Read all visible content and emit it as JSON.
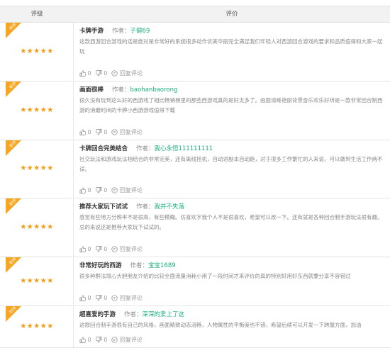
{
  "header": {
    "rating_label": "评级",
    "review_label": "评价"
  },
  "badge_text": "好评",
  "colors": {
    "badge": "#f5a623",
    "star": "#f39c12",
    "username": "#1aaf7a"
  },
  "reviews": [
    {
      "title": "卡牌手游",
      "author_label": "作者：",
      "username": "子健69",
      "stars": "★★★★★",
      "body": "这款西游回合游戏的话是绝对是非常好的系统很多动作优美华丽完全满足我们年轻人对西游回合游戏的要求和品质值得和大家一起玩",
      "likes": "0",
      "dislikes": "0",
      "reply": "回复评论"
    },
    {
      "title": "画面很棒",
      "author_label": "作者：",
      "username": "baohanbaorong",
      "stars": "★★★★★",
      "body": "很久没有玩到这么好的西游戏了相比畅销榜里的那些西游戏真的是好太多了。画面清晰艳丽背景音乐欢乐好听是一款非常回合制西游的消磨时间的卡牌小西游游戏值得下载",
      "likes": "0",
      "dislikes": "0",
      "reply": "回复评论"
    },
    {
      "title": "卡牌回合完美结合",
      "author_label": "作者：",
      "username": "我心永恒111111111",
      "stars": "★★★★★",
      "body": "社交玩法和游戏玩法相结合的非常完美，还有离线挂机，自动进副本自动跑，对于很多工作繁忙的人来说，可以做到生活工作两不误。",
      "likes": "0",
      "dislikes": "0",
      "reply": "回复评论"
    },
    {
      "title": "推荐大家玩下试试",
      "author_label": "作者：",
      "username": "我并不失落",
      "stars": "★★★★★",
      "body": "感觉有些地方分辨率不是很高，有些模糊。仿喜欢字我个人不是很喜欢，希望可以改一下。还有就是各种回合制手游玩法很有趣。总的来说还是推荐大家玩下试试的。",
      "likes": "0",
      "dislikes": "0",
      "reply": "回复评论"
    },
    {
      "title": "非常好玩的西游",
      "author_label": "作者：",
      "username": "宝宝1689",
      "stars": "★★★★★",
      "body": "很多种群法增心大胆朋友介绍的比较全面流量消耗小用了一段时间才来评价的真的特别好用好东西就要分享不容错过",
      "likes": "0",
      "dislikes": "0",
      "reply": "回复评论"
    },
    {
      "title": "超喜爱的手游",
      "author_label": "作者：",
      "username": "深深的爱上了这",
      "stars": "★★★★★",
      "body": "这款回合制手游很有自己的风格，画面精致动态流畅，人物属性的平衡度也不错，希望后续可以开发一下跨服方面，加油",
      "likes": "0",
      "dislikes": "0",
      "reply": "回复评论"
    }
  ]
}
